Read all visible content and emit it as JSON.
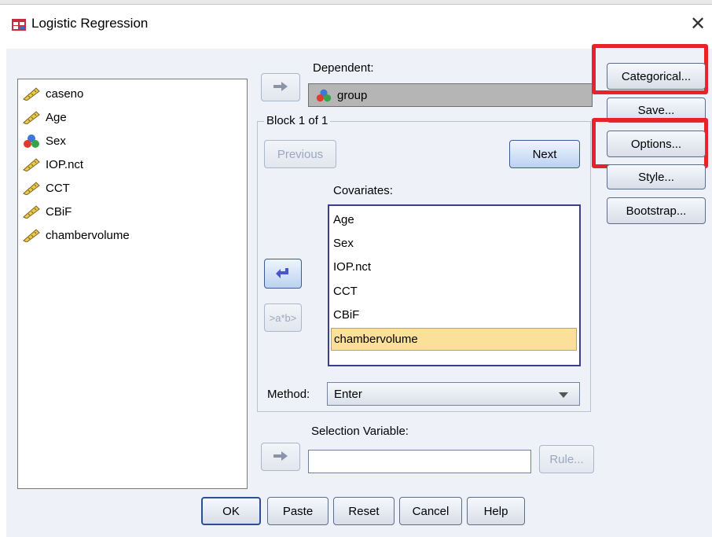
{
  "window": {
    "title": "Logistic Regression",
    "close_glyph": "✕"
  },
  "variables": [
    {
      "name": "caseno",
      "icon": "ruler-icon"
    },
    {
      "name": "Age",
      "icon": "ruler-icon"
    },
    {
      "name": "Sex",
      "icon": "nominal-icon"
    },
    {
      "name": "IOP.nct",
      "icon": "ruler-icon"
    },
    {
      "name": "CCT",
      "icon": "ruler-icon"
    },
    {
      "name": "CBiF",
      "icon": "ruler-icon"
    },
    {
      "name": "chambervolume",
      "icon": "ruler-icon"
    }
  ],
  "dependent": {
    "label": "Dependent:",
    "value": "group"
  },
  "block": {
    "label": "Block 1 of 1",
    "previous": "Previous",
    "next": "Next"
  },
  "covariates": {
    "label": "Covariates:",
    "items": [
      "Age",
      "Sex",
      "IOP.nct",
      "CCT",
      "CBiF",
      "chambervolume"
    ],
    "selected_index": 5
  },
  "interaction_button": ">a*b>",
  "method": {
    "label": "Method:",
    "value": "Enter"
  },
  "selection": {
    "label": "Selection Variable:",
    "value": "",
    "rule_button": "Rule..."
  },
  "side_buttons": {
    "categorical": "Categorical...",
    "save": "Save...",
    "options": "Options...",
    "style": "Style...",
    "bootstrap": "Bootstrap..."
  },
  "footer": {
    "ok": "OK",
    "paste": "Paste",
    "reset": "Reset",
    "cancel": "Cancel",
    "help": "Help"
  },
  "colors": {
    "highlight_red": "#e8222b",
    "selected_item": "#fbe09a",
    "client_bg": "#eef1f8"
  }
}
